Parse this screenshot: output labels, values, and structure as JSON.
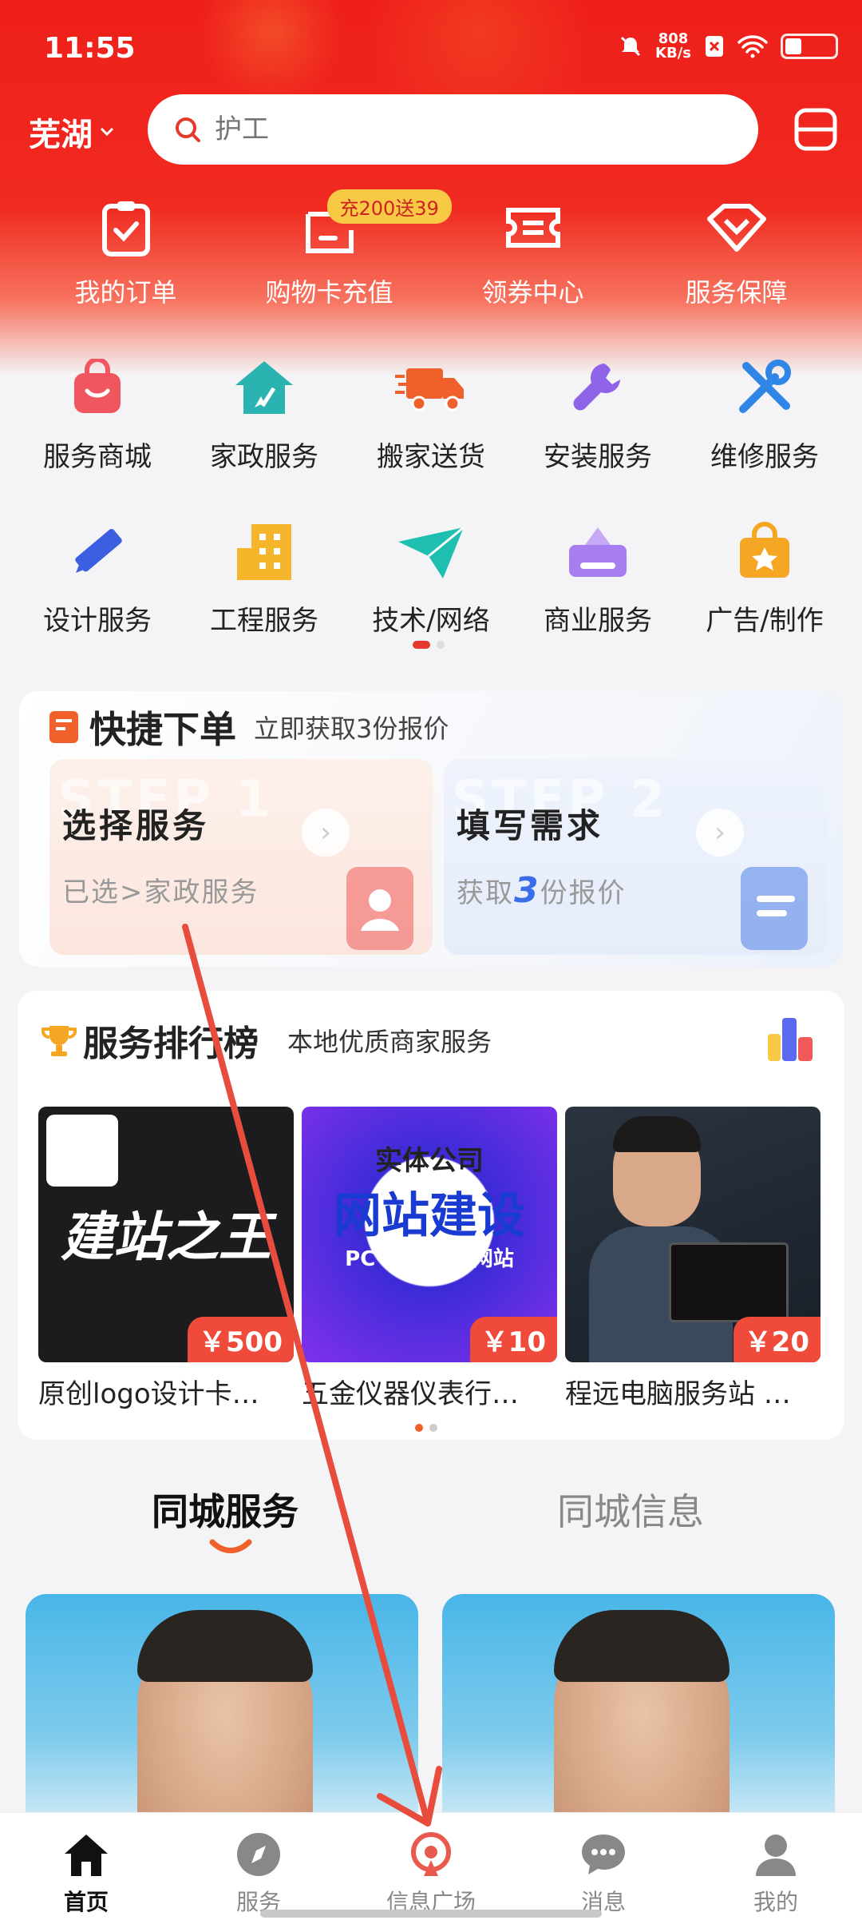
{
  "status": {
    "time": "11:55",
    "net_speed": "808",
    "net_unit": "KB/s"
  },
  "header": {
    "city": "芜湖",
    "search_placeholder": "护工"
  },
  "quick_actions": [
    {
      "label": "我的订单"
    },
    {
      "label": "购物卡充值",
      "badge": "充200送39"
    },
    {
      "label": "领券中心"
    },
    {
      "label": "服务保障"
    }
  ],
  "categories": [
    {
      "label": "服务商城"
    },
    {
      "label": "家政服务"
    },
    {
      "label": "搬家送货"
    },
    {
      "label": "安装服务"
    },
    {
      "label": "维修服务"
    },
    {
      "label": "设计服务"
    },
    {
      "label": "工程服务"
    },
    {
      "label": "技术/网络"
    },
    {
      "label": "商业服务"
    },
    {
      "label": "广告/制作"
    }
  ],
  "quick_order": {
    "title": "快捷下单",
    "subtitle": "立即获取3份报价",
    "step1": {
      "bg": "STEP 1",
      "title": "选择服务",
      "sub": "已选>家政服务"
    },
    "step2": {
      "bg": "STEP 2",
      "title": "填写需求",
      "sub_pre": "获取",
      "sub_num": "3",
      "sub_post": "份报价"
    }
  },
  "ranking": {
    "title": "服务排行榜",
    "subtitle": "本地优质商家服务",
    "products": [
      {
        "name": "原创logo设计卡…",
        "price": "￥500",
        "img_text": "建站之王"
      },
      {
        "name": "五金仪器仪表行…",
        "price": "￥10",
        "img_text": "网站建设",
        "img_top": "实体公司",
        "img_sub": "PC+移动+微网站"
      },
      {
        "name": "程远电脑服务站 …",
        "price": "￥20"
      }
    ]
  },
  "tabs": [
    {
      "label": "同城服务",
      "active": true
    },
    {
      "label": "同城信息",
      "active": false
    }
  ],
  "bottom_nav": [
    {
      "label": "首页",
      "icon": "home-icon",
      "active": true
    },
    {
      "label": "服务",
      "icon": "compass-icon"
    },
    {
      "label": "信息广场",
      "icon": "broadcast-icon"
    },
    {
      "label": "消息",
      "icon": "chat-icon"
    },
    {
      "label": "我的",
      "icon": "user-icon"
    }
  ],
  "colors": {
    "brand_red": "#ef1f1a",
    "accent_orange": "#f0602a",
    "annotation_arrow": "#e84c3d"
  }
}
